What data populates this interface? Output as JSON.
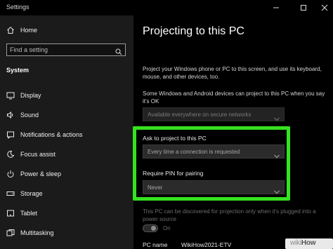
{
  "window": {
    "title": "Settings",
    "controls": [
      "minimize-icon",
      "maximize-icon",
      "close-icon"
    ]
  },
  "sidebar": {
    "home_label": "Home",
    "search_placeholder": "Find a setting",
    "section_label": "System",
    "items": [
      {
        "label": "Display",
        "icon": "display-icon"
      },
      {
        "label": "Sound",
        "icon": "sound-icon"
      },
      {
        "label": "Notifications & actions",
        "icon": "notifications-icon"
      },
      {
        "label": "Focus assist",
        "icon": "focus-assist-icon"
      },
      {
        "label": "Power & sleep",
        "icon": "power-icon"
      },
      {
        "label": "Storage",
        "icon": "storage-icon"
      },
      {
        "label": "Tablet",
        "icon": "tablet-icon"
      },
      {
        "label": "Multitasking",
        "icon": "multitasking-icon"
      }
    ]
  },
  "main": {
    "title": "Projecting to this PC",
    "intro": "Project your Windows phone or PC to this screen, and use its keyboard, mouse, and other devices, too.",
    "availability_text": "Some Windows and Android devices can project to this PC when you say it's OK",
    "availability_value": "Available everywhere on secure networks",
    "ask_label": "Ask to project to this PC",
    "ask_value": "Every time a connection is requested",
    "pin_label": "Require PIN for pairing",
    "pin_value": "Never",
    "power_text": "This PC can be discovered for projection only when it's plugged into a power source",
    "toggle_label": "On",
    "toggle_state": true,
    "pc_name_label": "PC name",
    "pc_name_value": "WikiHow2021-ETV"
  },
  "highlight_color": "#35e21f",
  "watermark": {
    "text_light": "wiki",
    "text_bold": "How"
  }
}
